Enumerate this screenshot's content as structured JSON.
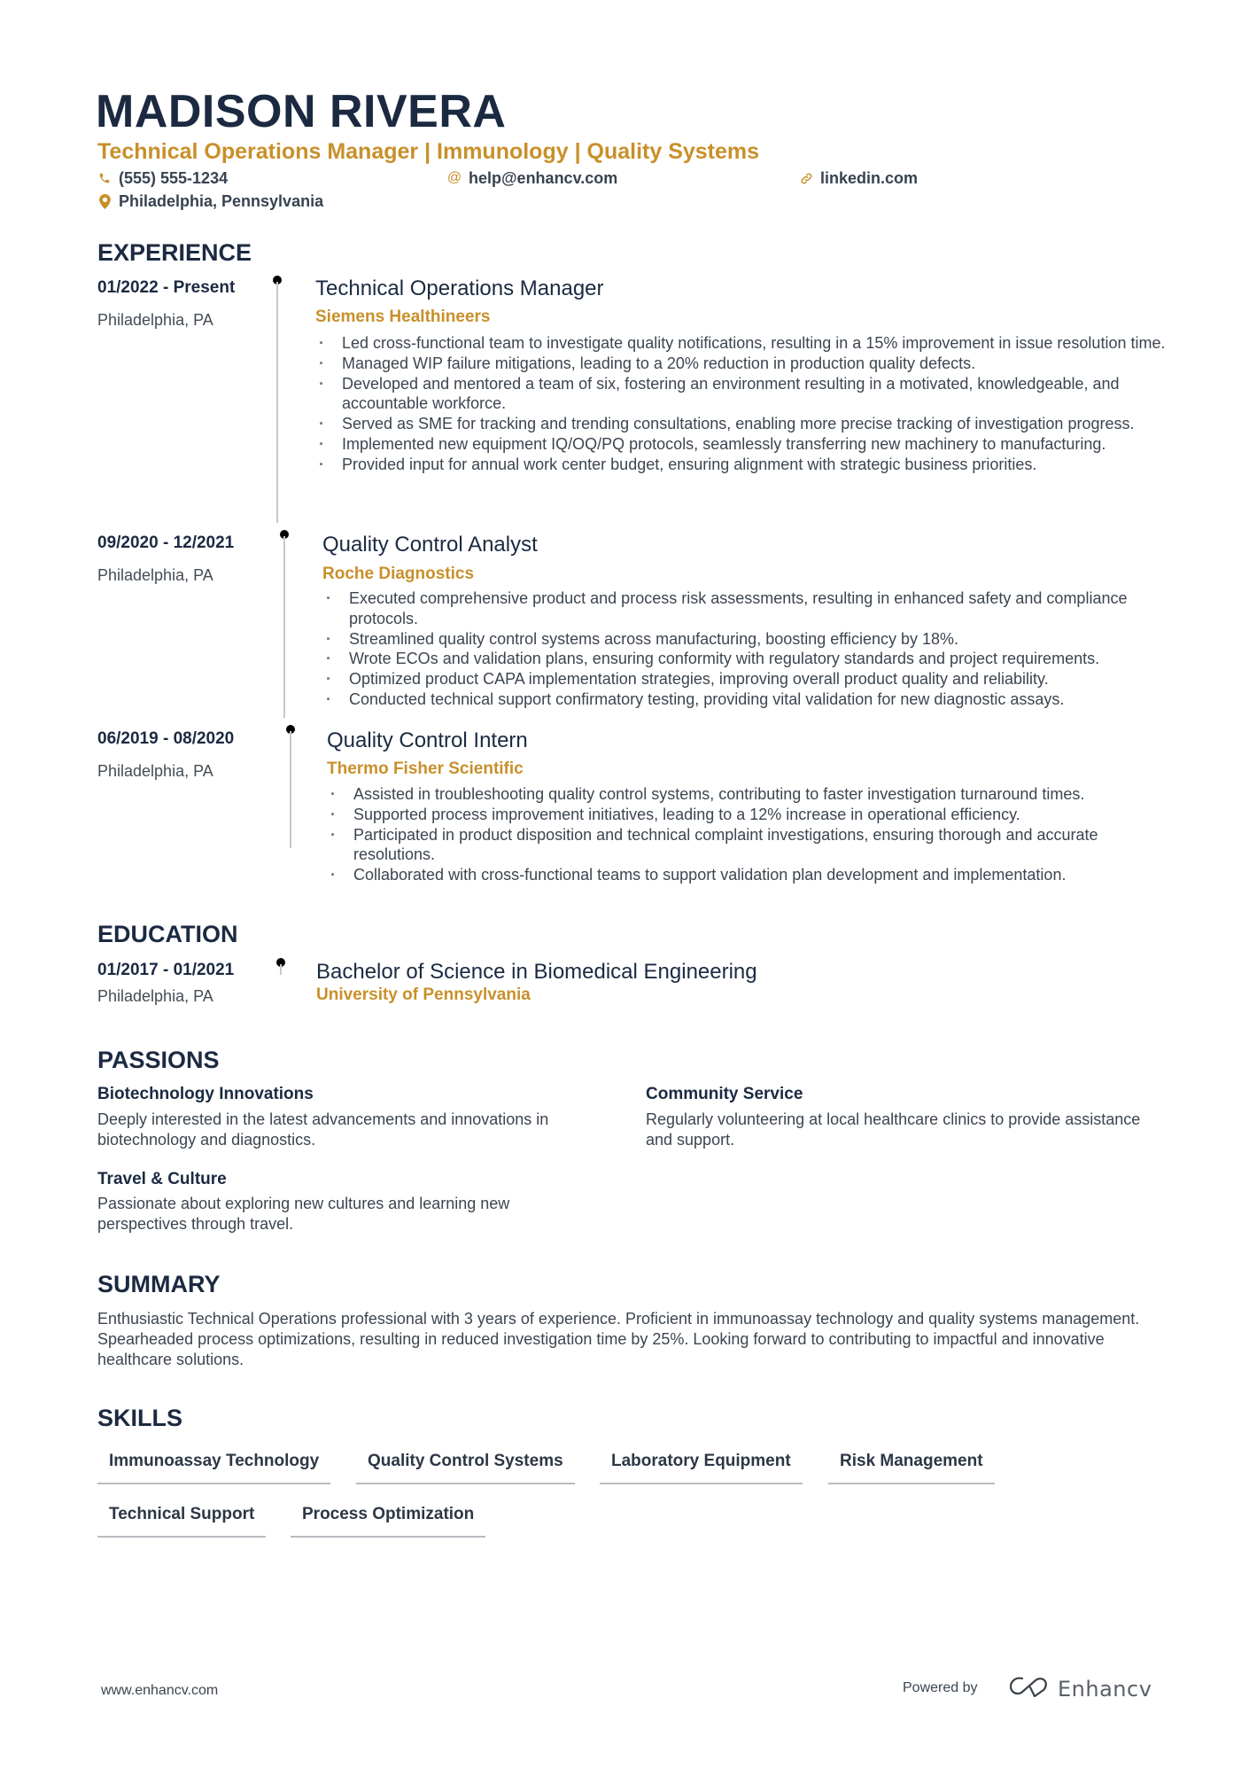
{
  "header": {
    "name": "MADISON RIVERA",
    "subtitle": "Technical Operations Manager | Immunology | Quality Systems",
    "contacts": {
      "phone": {
        "icon": "phone-icon",
        "text": "(555) 555-1234"
      },
      "email": {
        "icon": "at-icon",
        "text": "help@enhancv.com"
      },
      "link": {
        "icon": "link-icon",
        "text": "linkedin.com"
      },
      "location": {
        "icon": "map-pin-icon",
        "text": "Philadelphia, Pennsylvania"
      }
    }
  },
  "colors": {
    "accent": "#c8902a",
    "heading": "#1b2a41",
    "body": "#3c4550"
  },
  "experience": {
    "title": "EXPERIENCE",
    "jobs": [
      {
        "date": "01/2022 - Present",
        "location": "Philadelphia, PA",
        "title": "Technical Operations Manager",
        "company": "Siemens Healthineers",
        "bullets": [
          "Led cross-functional team to investigate quality notifications, resulting in a 15% improvement in issue resolution time.",
          "Managed WIP failure mitigations, leading to a 20% reduction in production quality defects.",
          "Developed and mentored a team of six, fostering an environment resulting in a motivated, knowledgeable, and accountable workforce.",
          "Served as SME for tracking and trending consultations, enabling more precise tracking of investigation progress.",
          "Implemented new equipment IQ/OQ/PQ protocols, seamlessly transferring new machinery to manufacturing.",
          "Provided input for annual work center budget, ensuring alignment with strategic business priorities."
        ]
      },
      {
        "date": "09/2020 - 12/2021",
        "location": "Philadelphia, PA",
        "title": "Quality Control Analyst",
        "company": "Roche Diagnostics",
        "bullets": [
          "Executed comprehensive product and process risk assessments, resulting in enhanced safety and compliance protocols.",
          "Streamlined quality control systems across manufacturing, boosting efficiency by 18%.",
          "Wrote ECOs and validation plans, ensuring conformity with regulatory standards and project requirements.",
          "Optimized product CAPA implementation strategies, improving overall product quality and reliability.",
          "Conducted technical support confirmatory testing, providing vital validation for new diagnostic assays."
        ]
      },
      {
        "date": "06/2019 - 08/2020",
        "location": "Philadelphia, PA",
        "title": "Quality Control Intern",
        "company": "Thermo Fisher Scientific",
        "bullets": [
          "Assisted in troubleshooting quality control systems, contributing to faster investigation turnaround times.",
          "Supported process improvement initiatives, leading to a 12% increase in operational efficiency.",
          "Participated in product disposition and technical complaint investigations, ensuring thorough and accurate resolutions.",
          "Collaborated with cross-functional teams to support validation plan development and implementation."
        ]
      }
    ]
  },
  "education": {
    "title": "EDUCATION",
    "items": [
      {
        "date": "01/2017 - 01/2021",
        "location": "Philadelphia, PA",
        "degree": "Bachelor of Science in Biomedical Engineering",
        "school": "University of Pennsylvania"
      }
    ]
  },
  "passions": {
    "title": "PASSIONS",
    "items": [
      {
        "title": "Biotechnology Innovations",
        "description": "Deeply interested in the latest advancements and innovations in biotechnology and diagnostics."
      },
      {
        "title": "Community Service",
        "description": "Regularly volunteering at local healthcare clinics to provide assistance and support."
      },
      {
        "title": "Travel & Culture",
        "description": "Passionate about exploring new cultures and learning new perspectives through travel."
      }
    ]
  },
  "summary": {
    "title": "SUMMARY",
    "text": "Enthusiastic Technical Operations professional with 3 years of experience. Proficient in immunoassay technology and quality systems management. Spearheaded process optimizations, resulting in reduced investigation time by 25%. Looking forward to contributing to impactful and innovative healthcare solutions."
  },
  "skills": {
    "title": "SKILLS",
    "items": [
      "Immunoassay Technology",
      "Quality Control Systems",
      "Laboratory Equipment",
      "Risk Management",
      "Technical Support",
      "Process Optimization"
    ]
  },
  "footer": {
    "url": "www.enhancv.com",
    "powered_by": "Powered by",
    "brand": "Enhancv"
  }
}
